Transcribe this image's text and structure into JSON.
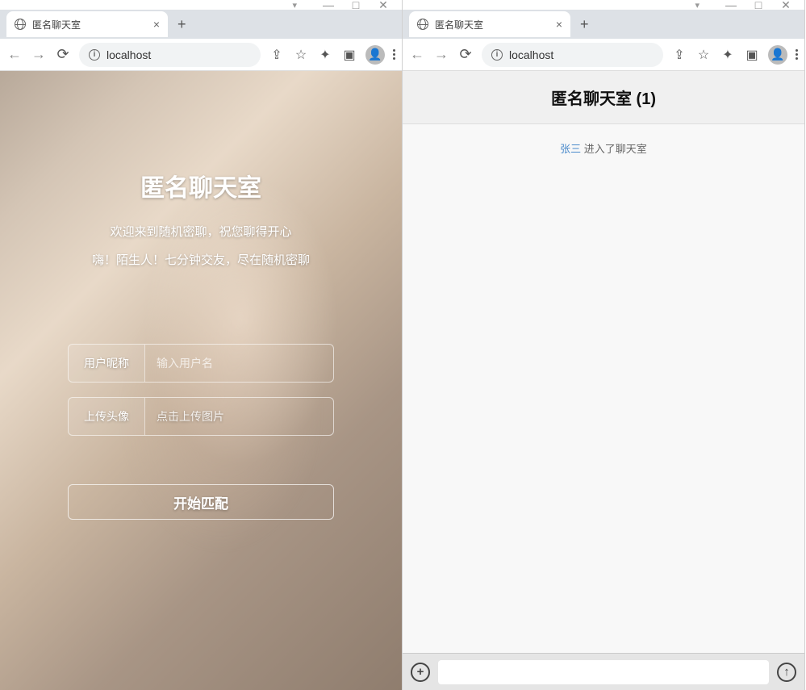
{
  "left": {
    "tab_title": "匿名聊天室",
    "address": "localhost",
    "page": {
      "title": "匿名聊天室",
      "subtitle1": "欢迎来到随机密聊，祝您聊得开心",
      "subtitle2": "嗨！陌生人！七分钟交友，尽在随机密聊",
      "nickname_label": "用户昵称",
      "nickname_placeholder": "输入用户名",
      "upload_label": "上传头像",
      "upload_hint": "点击上传图片",
      "match_button": "开始匹配"
    }
  },
  "right": {
    "tab_title": "匿名聊天室",
    "address": "localhost",
    "page": {
      "header": "匿名聊天室 (1)",
      "system_user": "张三",
      "system_action": " 进入了聊天室"
    }
  }
}
